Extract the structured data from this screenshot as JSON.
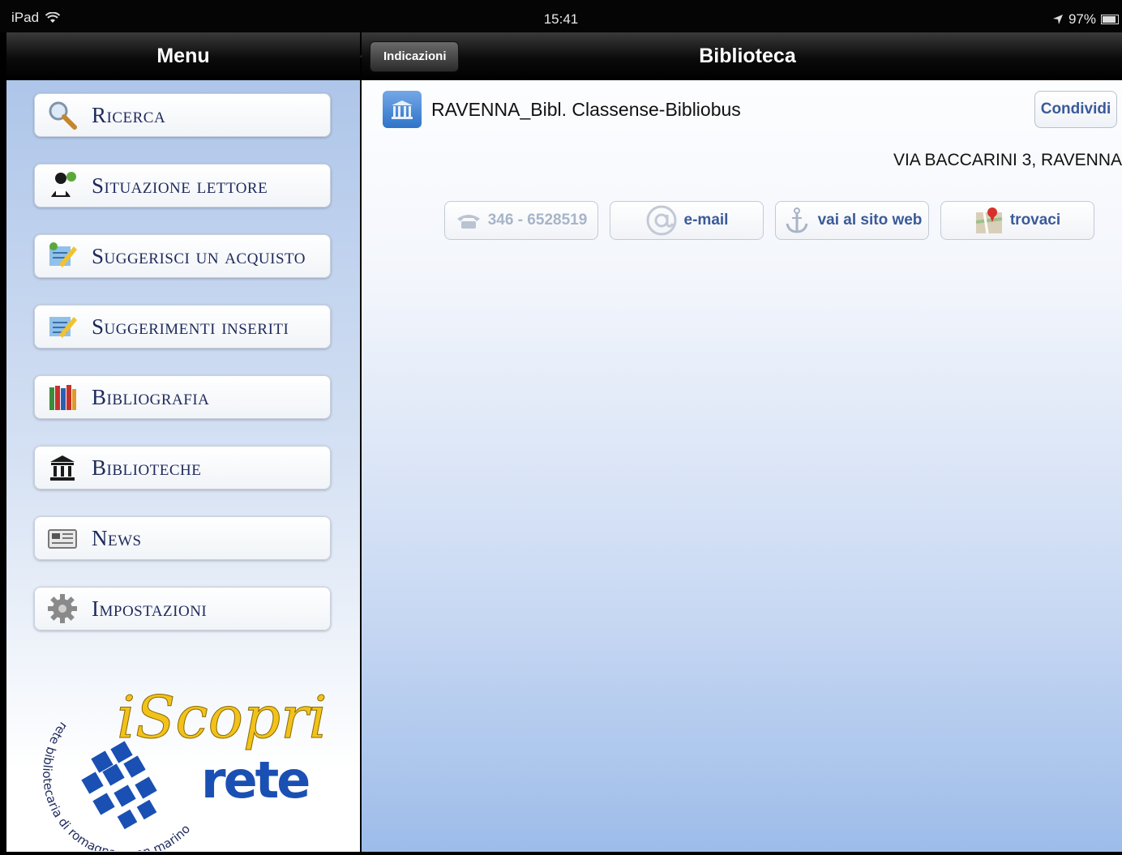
{
  "statusbar": {
    "device": "iPad",
    "time": "15:41",
    "battery": "97%"
  },
  "menu": {
    "title": "Menu",
    "items": [
      {
        "label": "Ricerca",
        "icon": "search-icon"
      },
      {
        "label": "Situazione lettore",
        "icon": "reader-status-icon"
      },
      {
        "label": "Suggerisci un acquisto",
        "icon": "suggest-purchase-icon"
      },
      {
        "label": "Suggerimenti inseriti",
        "icon": "suggestions-list-icon"
      },
      {
        "label": "Bibliografia",
        "icon": "books-icon"
      },
      {
        "label": "Biblioteche",
        "icon": "library-building-icon"
      },
      {
        "label": "News",
        "icon": "newspaper-icon"
      },
      {
        "label": "Impostazioni",
        "icon": "gear-icon"
      }
    ],
    "logo": {
      "title": "iScopri",
      "subtitle": "rete",
      "ring_text": "rete bibliotecaria di romagna e san marino"
    }
  },
  "detail": {
    "title": "Biblioteca",
    "back_label": "Indicazioni",
    "library_name": "RAVENNA_Bibl. Classense-Bibliobus",
    "share_label": "Condividi",
    "address": "VIA BACCARINI 3, RAVENNA",
    "actions": {
      "phone": "346 - 6528519",
      "email": "e-mail",
      "website": "vai al sito web",
      "map": "trovaci"
    }
  }
}
